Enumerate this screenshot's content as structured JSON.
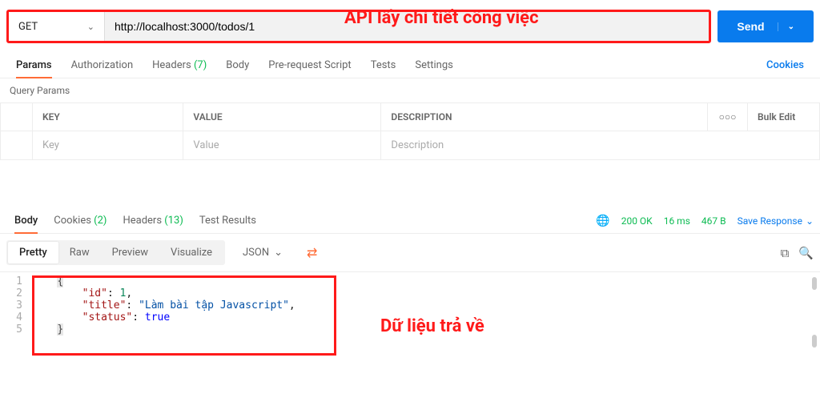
{
  "request": {
    "method": "GET",
    "url": "http://localhost:3000/todos/1",
    "send_label": "Send"
  },
  "annotations": {
    "top": "API lấy chi tiết công việc",
    "bottom": "Dữ liệu trả về"
  },
  "request_tabs": {
    "params": "Params",
    "authorization": "Authorization",
    "headers": "Headers",
    "headers_count": "(7)",
    "body": "Body",
    "prerequest": "Pre-request Script",
    "tests": "Tests",
    "settings": "Settings",
    "cookies": "Cookies"
  },
  "query_params": {
    "heading": "Query Params",
    "cols": {
      "key": "KEY",
      "value": "VALUE",
      "description": "DESCRIPTION",
      "more": "○○○",
      "bulk": "Bulk Edit"
    },
    "placeholders": {
      "key": "Key",
      "value": "Value",
      "description": "Description"
    }
  },
  "response_tabs": {
    "body": "Body",
    "cookies": "Cookies",
    "cookies_count": "(2)",
    "headers": "Headers",
    "headers_count": "(13)",
    "test_results": "Test Results"
  },
  "response_status": {
    "code": "200 OK",
    "time": "16 ms",
    "size": "467 B",
    "save": "Save Response"
  },
  "view": {
    "pretty": "Pretty",
    "raw": "Raw",
    "preview": "Preview",
    "visualize": "Visualize",
    "format": "JSON"
  },
  "json_body": {
    "id_key": "\"id\"",
    "id_val": "1",
    "title_key": "\"title\"",
    "title_val": "\"Làm bài tập Javascript\"",
    "status_key": "\"status\"",
    "status_val": "true"
  }
}
